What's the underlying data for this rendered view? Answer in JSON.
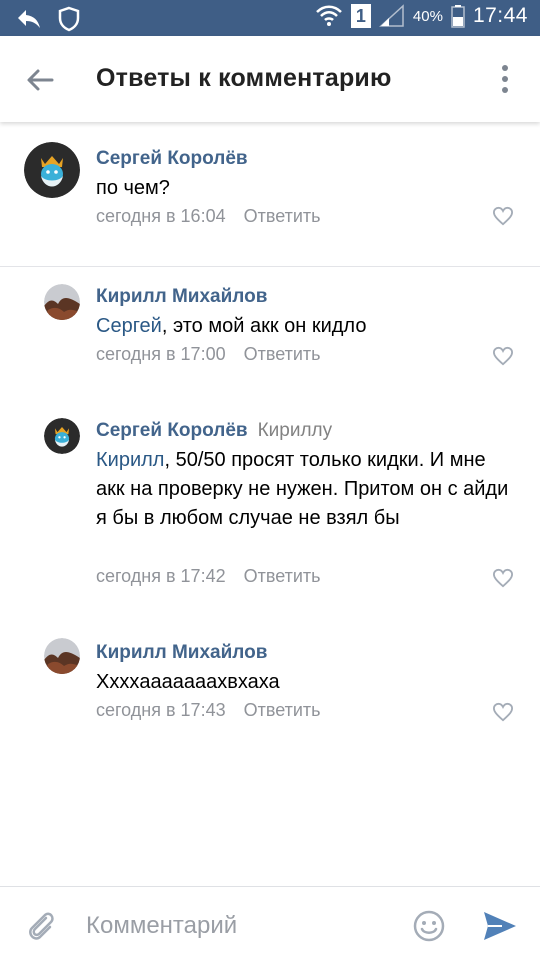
{
  "status_bar": {
    "battery": "40%",
    "time": "17:44",
    "sim_label": "1"
  },
  "header": {
    "title": "Ответы к комментарию"
  },
  "colors": {
    "status_bar": "#3f5e86",
    "author": "#42648b",
    "mention": "#2a5885",
    "meta": "#909399",
    "send": "#5181b8"
  },
  "comments": [
    {
      "author": "Сергей Королёв",
      "reply_to": "",
      "mention": "",
      "text": "по чем?",
      "time": "сегодня в 16:04",
      "reply_label": "Ответить",
      "avatar": "king-avatar"
    },
    {
      "author": "Кирилл Михайлов",
      "reply_to": "",
      "mention": "Сергей",
      "text": ", это мой акк он кидло",
      "time": "сегодня в 17:00",
      "reply_label": "Ответить",
      "avatar": "photo-avatar"
    },
    {
      "author": "Сергей Королёв",
      "reply_to": "Кириллу",
      "mention": "Кирилл",
      "text": ", 50/50 просят только кидки. И мне акк на проверку не нужен. Притом он с айди я бы в любом случае не взял бы",
      "time": "сегодня в 17:42",
      "reply_label": "Ответить",
      "avatar": "king-avatar"
    },
    {
      "author": "Кирилл Михайлов",
      "reply_to": "",
      "mention": "",
      "text": "Хххxааааааахвхаха",
      "time": "сегодня в 17:43",
      "reply_label": "Ответить",
      "avatar": "photo-avatar"
    }
  ],
  "composer": {
    "placeholder": "Комментарий"
  }
}
